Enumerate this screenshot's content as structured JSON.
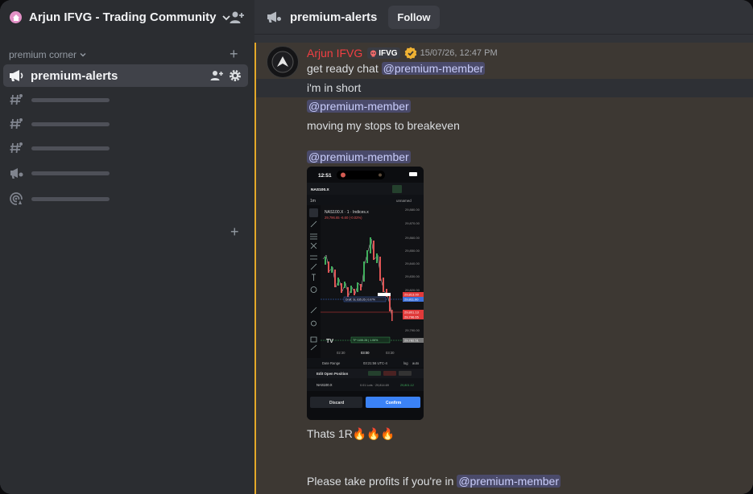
{
  "server": {
    "name": "Arjun IFVG - Trading Community"
  },
  "sidebar": {
    "category": "premium corner",
    "active_channel": "premium-alerts"
  },
  "channel": {
    "title": "premium-alerts",
    "follow_label": "Follow"
  },
  "message": {
    "author": "Arjun IFVG",
    "tag": "IFVG",
    "timestamp": "15/07/26, 12:47 PM",
    "lines": {
      "l1_text": "get ready chat ",
      "l1_mention": "@premium-member",
      "l2_text": "i'm in short",
      "l3_mention": "@premium-member",
      "l4_text": "moving my stops to breakeven",
      "l5_mention": "@premium-member",
      "l6_text": "Thats 1R",
      "l6_emoji": "🔥🔥🔥",
      "l7_text": "Please take profits if you're in ",
      "l7_mention": "@premium-member"
    }
  },
  "attachment": {
    "status_time": "12:51",
    "symbol": "NAS100.X",
    "interval": "1m",
    "layout_name": "unnamed",
    "chart_title": "NAS100.X · 1 · Indices.x",
    "chart_ohlc": "29,796.65 -6.60 (-0.02%)",
    "price_ticks": [
      "29,880.00",
      "29,870.00",
      "29,860.00",
      "29,850.00",
      "29,840.00",
      "29,830.00",
      "29,820.00",
      "29,813.00",
      "29,811.00",
      "29,801.13",
      "29,796.65",
      "29,790.00",
      "29,782.51"
    ],
    "time_ticks": [
      "02:30",
      "03:00",
      "03:30"
    ],
    "draft_label": "Draft: SL 635.26 | 0.07%",
    "tp_label": "TP 1155.28 | 1.06%",
    "date_range": "Date Range",
    "clock": "03:21:56 UTC-4",
    "log_label": "log",
    "auto_label": "auto",
    "edit_open_position": "Edit Open Position",
    "pos_symbol": "NAS100.X",
    "pos_detail": "0.01 Lots · 29,814.69",
    "pos_pl": "29,801.12",
    "discard": "Discard",
    "confirm": "Confirm"
  },
  "colors": {
    "accent_gold": "#e4a829",
    "author_red": "#f23f43",
    "mention_bg": "#4a4a6a",
    "confirm_blue": "#3b82f6"
  }
}
